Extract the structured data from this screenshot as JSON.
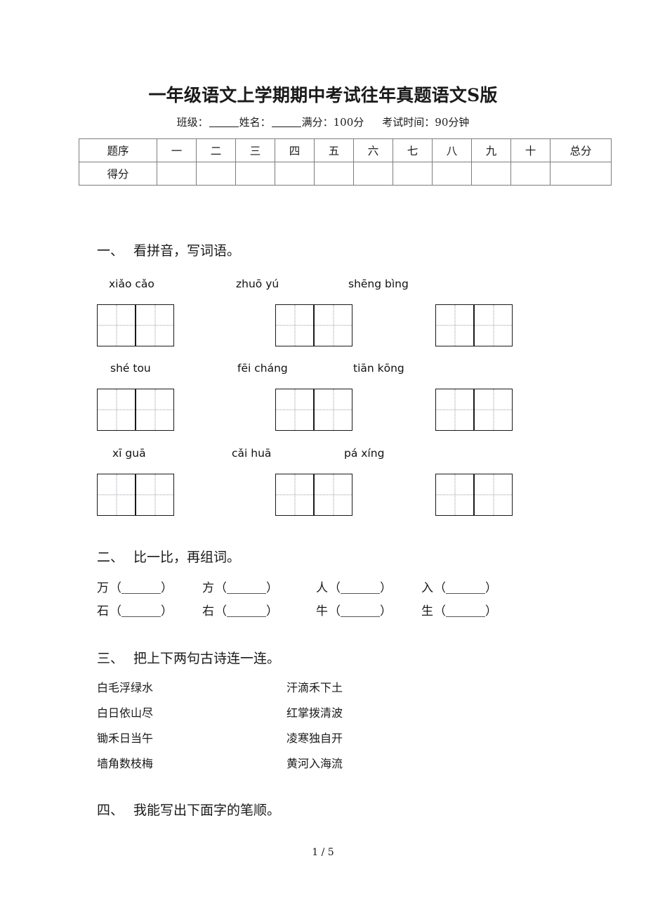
{
  "document": {
    "title": "一年级语文上学期期中考试往年真题语文S版",
    "info_line": {
      "class_label": "班级：",
      "name_label": "姓名：",
      "full_score_label": "满分：",
      "full_score_value": "100分",
      "time_label": "考试时间：",
      "time_value": "90分钟"
    },
    "footer": "1 / 5"
  },
  "score_table": {
    "row_labels": [
      "题序",
      "得分"
    ],
    "columns": [
      "一",
      "二",
      "三",
      "四",
      "五",
      "六",
      "七",
      "八",
      "九",
      "十",
      "总分"
    ],
    "scores": [
      "",
      "",
      "",
      "",
      "",
      "",
      "",
      "",
      "",
      "",
      ""
    ]
  },
  "sections": [
    {
      "number": "一、",
      "title": "看拼音，写词语。",
      "pinyin_rows": [
        [
          "xiǎo cǎo",
          "zhuō yú",
          "shēng bìng"
        ],
        [
          "shé tou",
          "fēi cháng",
          "tiān kōng"
        ],
        [
          "xī guā",
          "cǎi huā",
          "pá xíng"
        ]
      ]
    },
    {
      "number": "二、",
      "title": "比一比，再组词。",
      "rows": [
        [
          "万",
          "方",
          "人",
          "入"
        ],
        [
          "石",
          "右",
          "牛",
          "生"
        ]
      ]
    },
    {
      "number": "三、",
      "title": "把上下两句古诗连一连。",
      "left_lines": [
        "白毛浮绿水",
        "白日依山尽",
        "锄禾日当午",
        "墙角数枝梅"
      ],
      "right_lines": [
        "汗滴禾下土",
        "红掌拨清波",
        "凌寒独自开",
        "黄河入海流"
      ]
    },
    {
      "number": "四、",
      "title": "我能写出下面字的笔顺。"
    }
  ]
}
